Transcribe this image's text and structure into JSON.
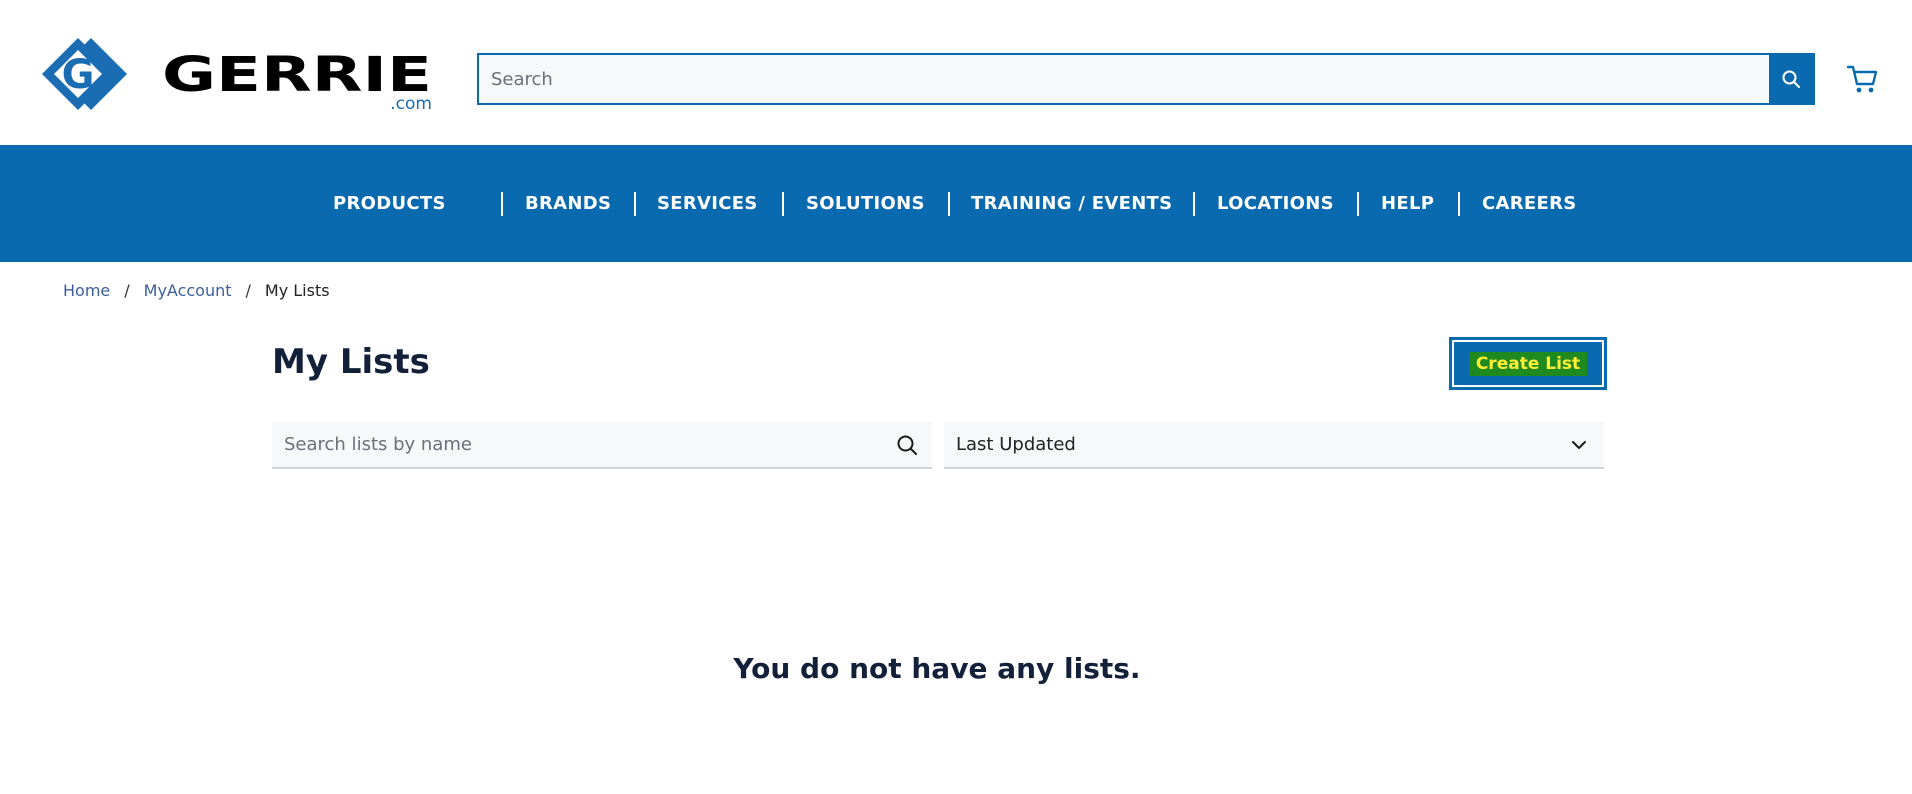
{
  "header": {
    "logo_text": "GERRIE",
    "logo_suffix": ".com",
    "search_placeholder": "Search"
  },
  "nav": {
    "items": [
      {
        "label": "PRODUCTS"
      },
      {
        "label": "BRANDS"
      },
      {
        "label": "SERVICES"
      },
      {
        "label": "SOLUTIONS"
      },
      {
        "label": "TRAINING / EVENTS"
      },
      {
        "label": "LOCATIONS"
      },
      {
        "label": "HELP"
      },
      {
        "label": "CAREERS"
      }
    ]
  },
  "breadcrumb": {
    "home": "Home",
    "account": "MyAccount",
    "current": "My Lists",
    "separator": "/"
  },
  "main": {
    "title": "My Lists",
    "create_label": "Create List",
    "list_search_placeholder": "Search lists by name",
    "sort_selected": "Last Updated",
    "empty_message": "You do not have any lists."
  },
  "colors": {
    "brand_blue": "#0a6aaf",
    "highlight_green": "#1f8a1f",
    "highlight_yellow": "#ffee33"
  },
  "icons": {
    "search": "search-icon",
    "cart": "cart-icon",
    "chevron": "chevron-down-icon"
  }
}
